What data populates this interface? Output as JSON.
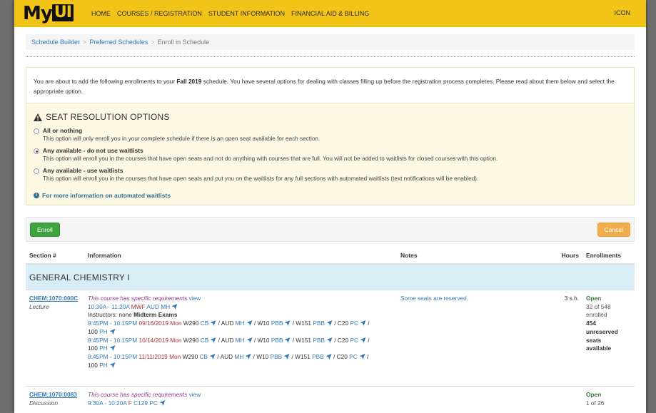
{
  "header": {
    "logo_prefix": "My",
    "logo_ui": "UI",
    "nav": [
      "HOME",
      "COURSES / REGISTRATION",
      "STUDENT INFORMATION",
      "FINANCIAL AID & BILLING"
    ],
    "nav_right": "ICON"
  },
  "breadcrumb": {
    "items": [
      "Schedule Builder",
      "Preferred Schedules"
    ],
    "separator": ">",
    "current": "Enroll in Schedule"
  },
  "intro": {
    "part1": "You are about to add the following enrollments to your ",
    "term": "Fall 2019",
    "part2": " schedule. You have several options for dealing with classes filling up before the registration process completes. Please read about them below and select the appropriate option."
  },
  "seat": {
    "title": "SEAT RESOLUTION OPTIONS",
    "options": [
      {
        "label": "All or nothing",
        "desc": "This option will only enroll you in your complete schedule if there is an open seat available for each section.",
        "selected": false
      },
      {
        "label": "Any available - do not use waitlists",
        "desc": "This option will enroll you in the courses that have open seats and not do anything with courses that are full. You will not be added to waitlists for closed courses with this option.",
        "selected": true
      },
      {
        "label": "Any available - use waitlists",
        "desc": "This option will enroll you in the courses that have open seats and put you on the waitlists for any full sections with automated waitlists (text notifications will be enabled).",
        "selected": false
      }
    ],
    "more_link": "For more information on automated waitlists"
  },
  "actions": {
    "enroll": "Enroll",
    "cancel": "Cancel"
  },
  "table": {
    "headers": [
      "Section #",
      "Information",
      "Notes",
      "Hours",
      "Enrollments"
    ],
    "course_title": "GENERAL CHEMISTRY I",
    "rows": [
      {
        "section": "CHEM:1070:000C",
        "type": "Lecture",
        "req": "This course has specific requirements",
        "req_link": "view",
        "time": "10:30A - 11:20A",
        "days": "MWF",
        "room": "AUD",
        "bldg": "MH",
        "instructors": "Instructors: none",
        "midterm": "Midterm Exams",
        "exams": [
          {
            "time": "8:45PM - 10:15PM",
            "date": "09/16/2019 Mon",
            "rooms": "W290",
            "wrap": "100"
          },
          {
            "time": "8:45PM - 10:15PM",
            "date": "10/14/2019 Mon",
            "rooms": "W290",
            "wrap": "100"
          },
          {
            "time": "8:45PM - 10:15PM",
            "date": "11/11/2019 Mon",
            "rooms": "W290",
            "wrap": "100"
          }
        ],
        "exam_locs": [
          "CB",
          "AUD",
          "MH",
          "W10",
          "PBB",
          "W151",
          "PBB",
          "C20",
          "PC",
          "PH"
        ],
        "notes": "Some seats are reserved.",
        "hours": "3 s.h.",
        "status": "Open",
        "enrolled": "32 of 548",
        "enrolled_word": "enrolled",
        "unreserved": "454",
        "unreserved_word": "unreserved",
        "seats_word": "seats",
        "available_word": "available"
      },
      {
        "section": "CHEM:1070:0083",
        "type": "Discussion",
        "req": "This course has specific requirements",
        "req_link": "view",
        "time": "9:30A - 10:20A",
        "days": "F",
        "room": "C129",
        "bldg": "PC",
        "status": "Open",
        "enrolled": "1 of 26"
      }
    ]
  },
  "colors": {
    "header": "#f2c417",
    "enroll": "#3fa33f",
    "cancel": "#f0ad4e",
    "course_head": "#d9edf7",
    "seat_bg": "#fcf8e3"
  }
}
